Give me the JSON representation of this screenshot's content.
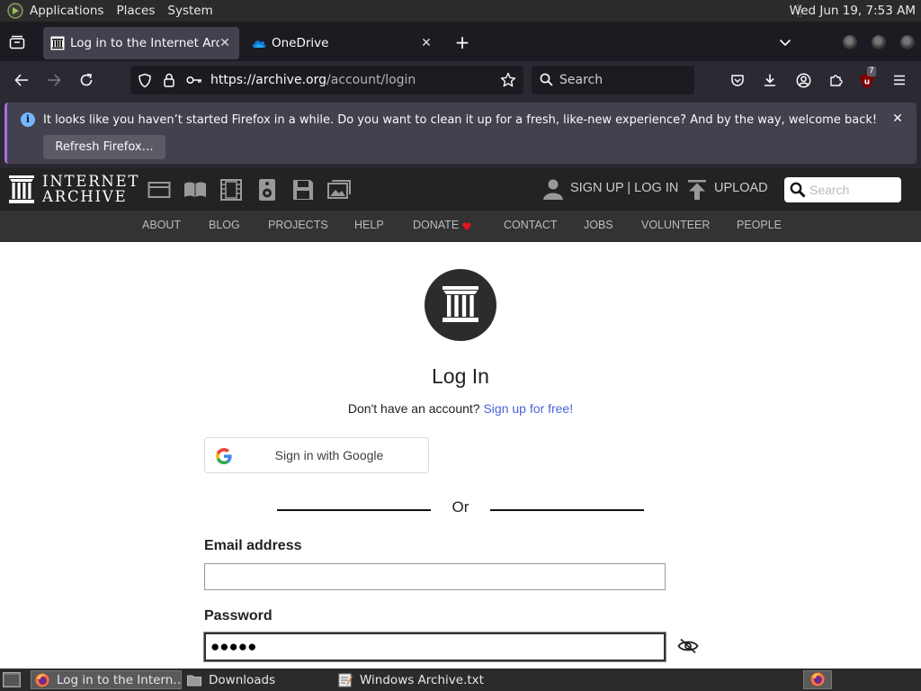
{
  "panel": {
    "menus": [
      "Applications",
      "Places",
      "System"
    ],
    "clock": "Wed Jun 19,  7:53 AM"
  },
  "browser": {
    "tabs": [
      {
        "title": "Log in to the Internet Archive",
        "icon": "archive-icon",
        "active": true
      },
      {
        "title": "OneDrive",
        "icon": "onedrive-icon",
        "active": false
      }
    ],
    "url_host": "https://archive.org",
    "url_path": "/account/login",
    "search_placeholder": "Search",
    "ublock_badge": "7",
    "notification": {
      "message": "It looks like you haven’t started Firefox in a while. Do you want to clean it up for a fresh, like-new experience? And by the way, welcome back!",
      "button": "Refresh Firefox…"
    }
  },
  "archive_header": {
    "logo_line1": "INTERNET",
    "logo_line2": "ARCHIVE",
    "signup_login": "SIGN UP | LOG IN",
    "upload": "UPLOAD",
    "search_placeholder": "Search",
    "subnav": [
      "ABOUT",
      "BLOG",
      "PROJECTS",
      "HELP",
      "DONATE",
      "CONTACT",
      "JOBS",
      "VOLUNTEER",
      "PEOPLE"
    ]
  },
  "login": {
    "title": "Log In",
    "no_account": "Don't have an account?",
    "signup_link": "Sign up for free!",
    "google_button": "Sign in with Google",
    "or": "Or",
    "email_label": "Email address",
    "email_value": "",
    "password_label": "Password",
    "password_mask": "●●●●●"
  },
  "taskbar": {
    "tasks": [
      "Log in to the Intern…",
      "Downloads",
      "Windows Archive.txt…"
    ]
  },
  "colors": {
    "link": "#4b64d9",
    "donate_heart": "#e0161b",
    "archive_dark": "#232323"
  }
}
